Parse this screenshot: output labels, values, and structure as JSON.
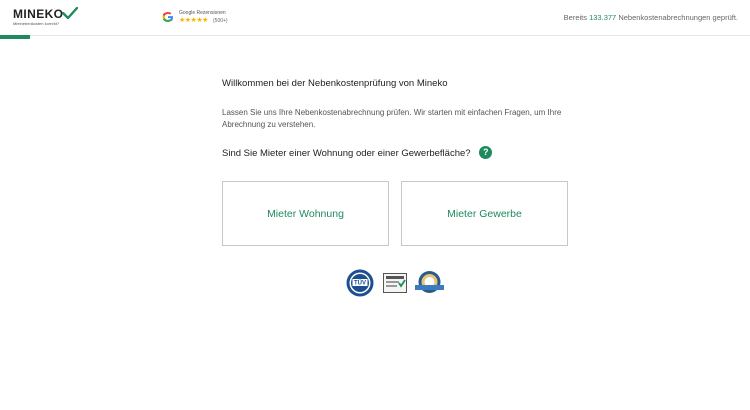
{
  "header": {
    "logo_text": "MINEKO",
    "logo_tagline": "Mietnebenkosten korrekt?",
    "google": {
      "title": "Google Rezensionen",
      "stars": "★★★★★",
      "count": "(500+)"
    },
    "counter": {
      "prefix": "Bereits",
      "number": "133.377",
      "suffix": "Nebenkostenabrechnungen geprüft."
    },
    "progress_fraction": 0.04
  },
  "main": {
    "welcome": "Willkommen bei der Nebenkostenprüfung von Mineko",
    "intro": "Lassen Sie uns Ihre Nebenkostenabrechnung prüfen. Wir starten mit einfachen Fragen, um Ihre Abrechnung zu verstehen.",
    "question": "Sind Sie Mieter einer Wohnung oder einer Gewerbefläche?",
    "help_symbol": "?",
    "options": [
      {
        "label": "Mieter Wohnung"
      },
      {
        "label": "Mieter Gewerbe"
      }
    ]
  },
  "badges": [
    {
      "name": "tuv-seal",
      "text": "TÜV"
    },
    {
      "name": "certificate-badge"
    },
    {
      "name": "award-seal"
    }
  ],
  "colors": {
    "accent": "#1f8a5e",
    "star": "#f5b301",
    "border": "#c8c8c8"
  }
}
